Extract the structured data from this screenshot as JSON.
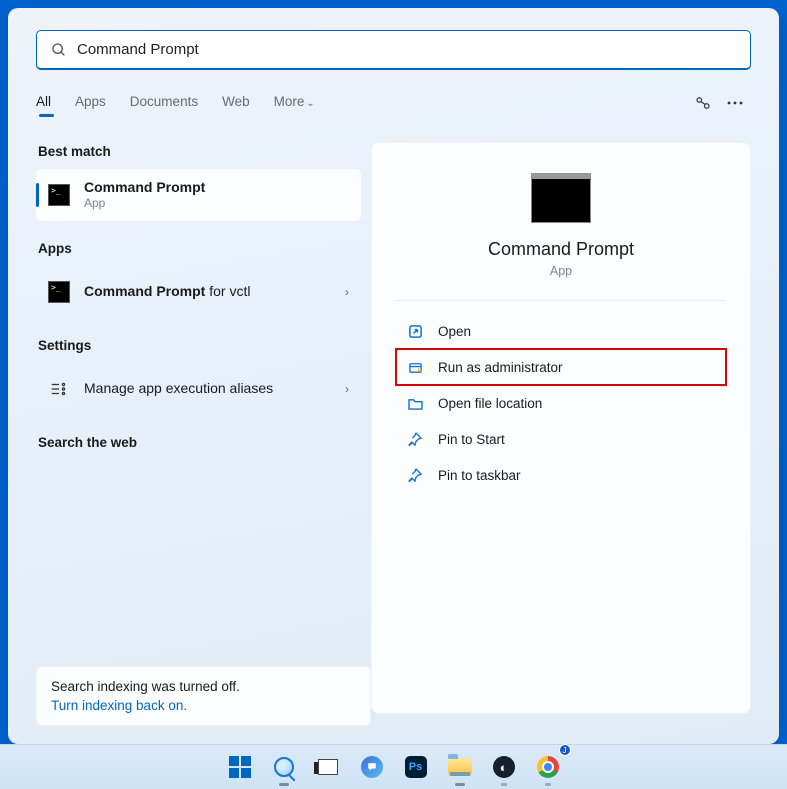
{
  "search": {
    "value": "Command Prompt"
  },
  "tabs": {
    "all": "All",
    "apps": "Apps",
    "documents": "Documents",
    "web": "Web",
    "more": "More"
  },
  "left": {
    "best_match_header": "Best match",
    "best_match": {
      "title": "Command Prompt",
      "sub": "App"
    },
    "apps_header": "Apps",
    "apps_item": {
      "title_bold": "Command Prompt",
      "title_rest": " for vctl"
    },
    "settings_header": "Settings",
    "settings_item": "Manage app execution aliases",
    "search_web_header": "Search the web"
  },
  "right": {
    "title": "Command Prompt",
    "sub": "App",
    "actions": {
      "open": "Open",
      "run_admin": "Run as administrator",
      "open_location": "Open file location",
      "pin_start": "Pin to Start",
      "pin_taskbar": "Pin to taskbar"
    }
  },
  "indexing": {
    "line1": "Search indexing was turned off.",
    "line2": "Turn indexing back on."
  },
  "chrome_badge": "J"
}
